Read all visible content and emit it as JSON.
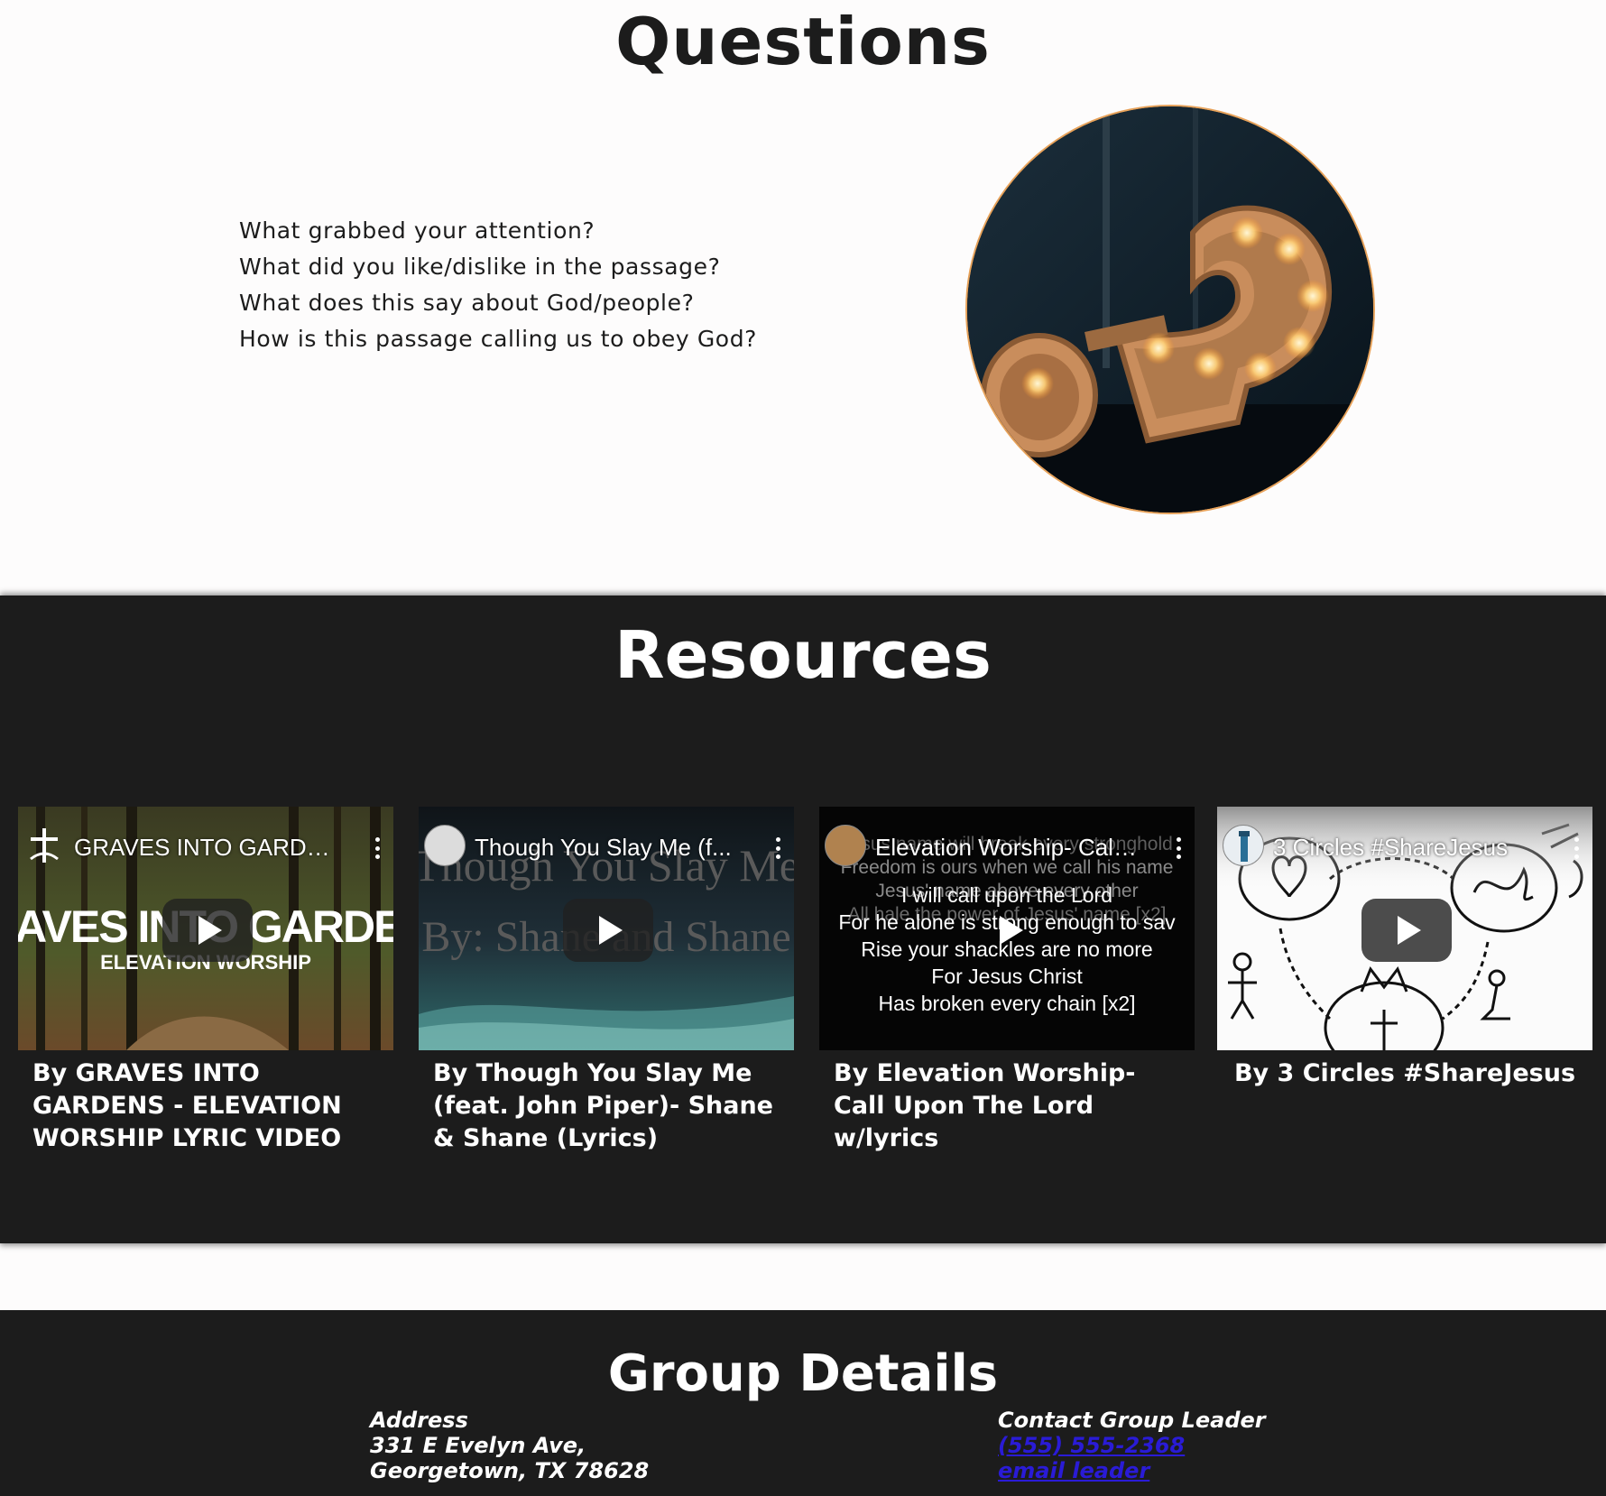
{
  "questions": {
    "title": "Questions",
    "items": [
      "What grabbed your attention?",
      "What did you like/dislike in the passage?",
      "What does this say about God/people?",
      "How is this passage calling us to obey God?"
    ]
  },
  "resources": {
    "title": "Resources",
    "videos": [
      {
        "thumb_title": "GRAVES INTO GARDEN...",
        "thumb_art_line1": "GRAVES INTO GARDENS",
        "thumb_art_line2": "ELEVATION WORSHIP",
        "caption": "By GRAVES INTO GARDENS - ELEVATION WORSHIP LYRIC VIDEO"
      },
      {
        "thumb_title": "Though You Slay Me (f...",
        "thumb_art_line1": "Though You Slay Me",
        "thumb_art_line2": "By: Shane and Shane",
        "caption": "By Though You Slay Me (feat. John Piper)- Shane & Shane (Lyrics)"
      },
      {
        "thumb_title": "Elevation Worship- Call...",
        "thumb_art_lines": [
          "Jesus name will break every stronghold",
          "Freedom is ours when we call his name",
          "Jesus' name above every other",
          "I will call upon the Lord",
          "All hale the power of Jesus' name [x2]",
          "For he alone is strong enough to sav",
          "Rise your shackles are no more",
          "For Jesus Christ",
          "Has broken every chain [x2]"
        ],
        "caption": "By Elevation Worship- Call Upon The Lord w/lyrics"
      },
      {
        "thumb_title": "3 Circles #ShareJesus",
        "caption": "By 3 Circles #ShareJesus"
      }
    ]
  },
  "group": {
    "title": "Group Details",
    "address_label": "Address",
    "address_line1": "331 E Evelyn Ave,",
    "address_line2": "Georgetown, TX 78628",
    "contact_label": "Contact Group Leader",
    "phone": "(555) 555-2368",
    "email_link": "email leader"
  },
  "colors": {
    "dark_section_bg": "#1c1c1c",
    "page_bg": "#fdfcfc",
    "link": "#2a1bd6",
    "photo_ring": "#e7a25a"
  }
}
